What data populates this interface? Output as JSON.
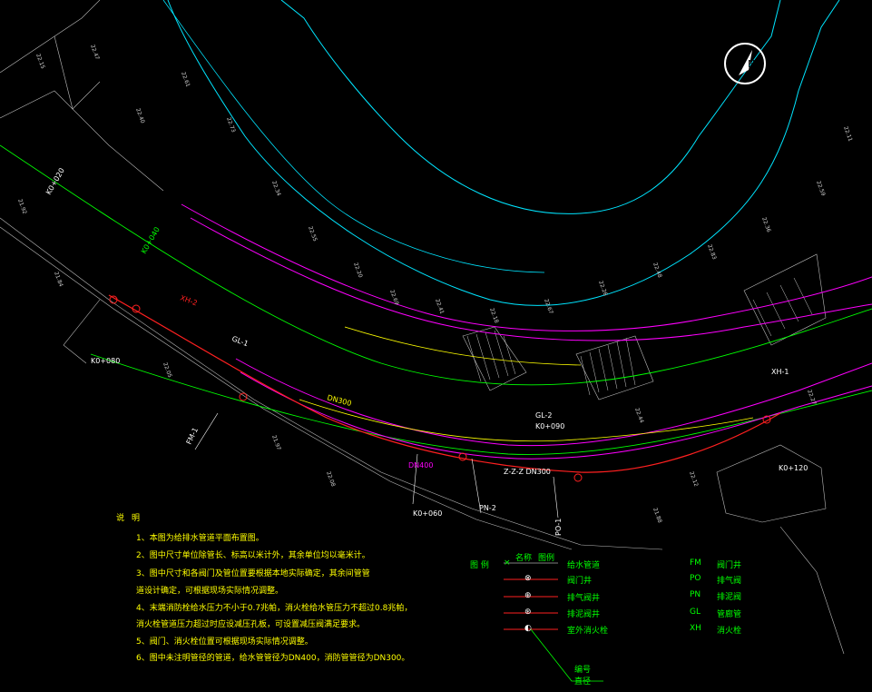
{
  "colors": {
    "background": "#000000",
    "river": "#00e5ff",
    "alignment_magenta": "#ff00ff",
    "alignment_green": "#00ff00",
    "red_pipe": "#ff2020",
    "yellow_line": "#ffff00",
    "terrain_text": "#d0d0d0"
  },
  "north_arrow": {
    "label": "N"
  },
  "map_labels": {
    "station_1": "K0+020",
    "station_2": "K0+040",
    "station_3": "K0+080",
    "station_4": "K0+060",
    "station_5": "K0+090",
    "station_6": "K0+120",
    "label_xh2": "XH-2",
    "label_gl1": "GL-1",
    "label_gl2": "GL-2",
    "label_pn": "PN-2",
    "label_fm": "FM-1",
    "label_po": "PO-1",
    "label_xh1": "XH-1",
    "pipe_dn_1": "DN300",
    "pipe_dn_2": "DN400",
    "pipe_dn_3": "Z-Z-Z DN300"
  },
  "notes": {
    "title": "说明",
    "lines": [
      "1、本图为给排水管道平面布置图。",
      "2、图中尺寸单位除管长、标高以米计外，其余单位均以毫米计。",
      "3、图中尺寸和各阀门及管位置要根据本地实际确定，其余间管管",
      "   道设计确定，可根据现场实际情况调整。",
      "4、末端消防栓给水压力不小于0.7兆帕，消火栓给水管压力不超过0.8兆帕，",
      "   消火栓管道压力超过时应设减压孔板，可设置减压阀满足要求。",
      "5、阀门、消火栓位置可根据现场实际情况调整。",
      "6、图中未注明管径的管道，给水管管径为DN400，消防管管径为DN300。"
    ]
  },
  "legend": {
    "title": "图 例",
    "header_symbol": "名称",
    "header_name": "图例",
    "items": [
      {
        "symbol": "×",
        "name": "给水管道"
      },
      {
        "symbol": "⊗",
        "name": "阀门井"
      },
      {
        "symbol": "⊕",
        "name": "排气阀井"
      },
      {
        "symbol": "⊛",
        "name": "排泥阀井"
      },
      {
        "symbol": "◐",
        "name": "室外消火栓"
      }
    ],
    "codes": [
      {
        "code": "FM",
        "name": "阀门井"
      },
      {
        "code": "PO",
        "name": "排气阀"
      },
      {
        "code": "PN",
        "name": "排泥阀"
      },
      {
        "code": "GL",
        "name": "管廊管"
      },
      {
        "code": "XH",
        "name": "消火栓"
      }
    ],
    "leader_label_1": "编号",
    "leader_label_2": "直径"
  }
}
